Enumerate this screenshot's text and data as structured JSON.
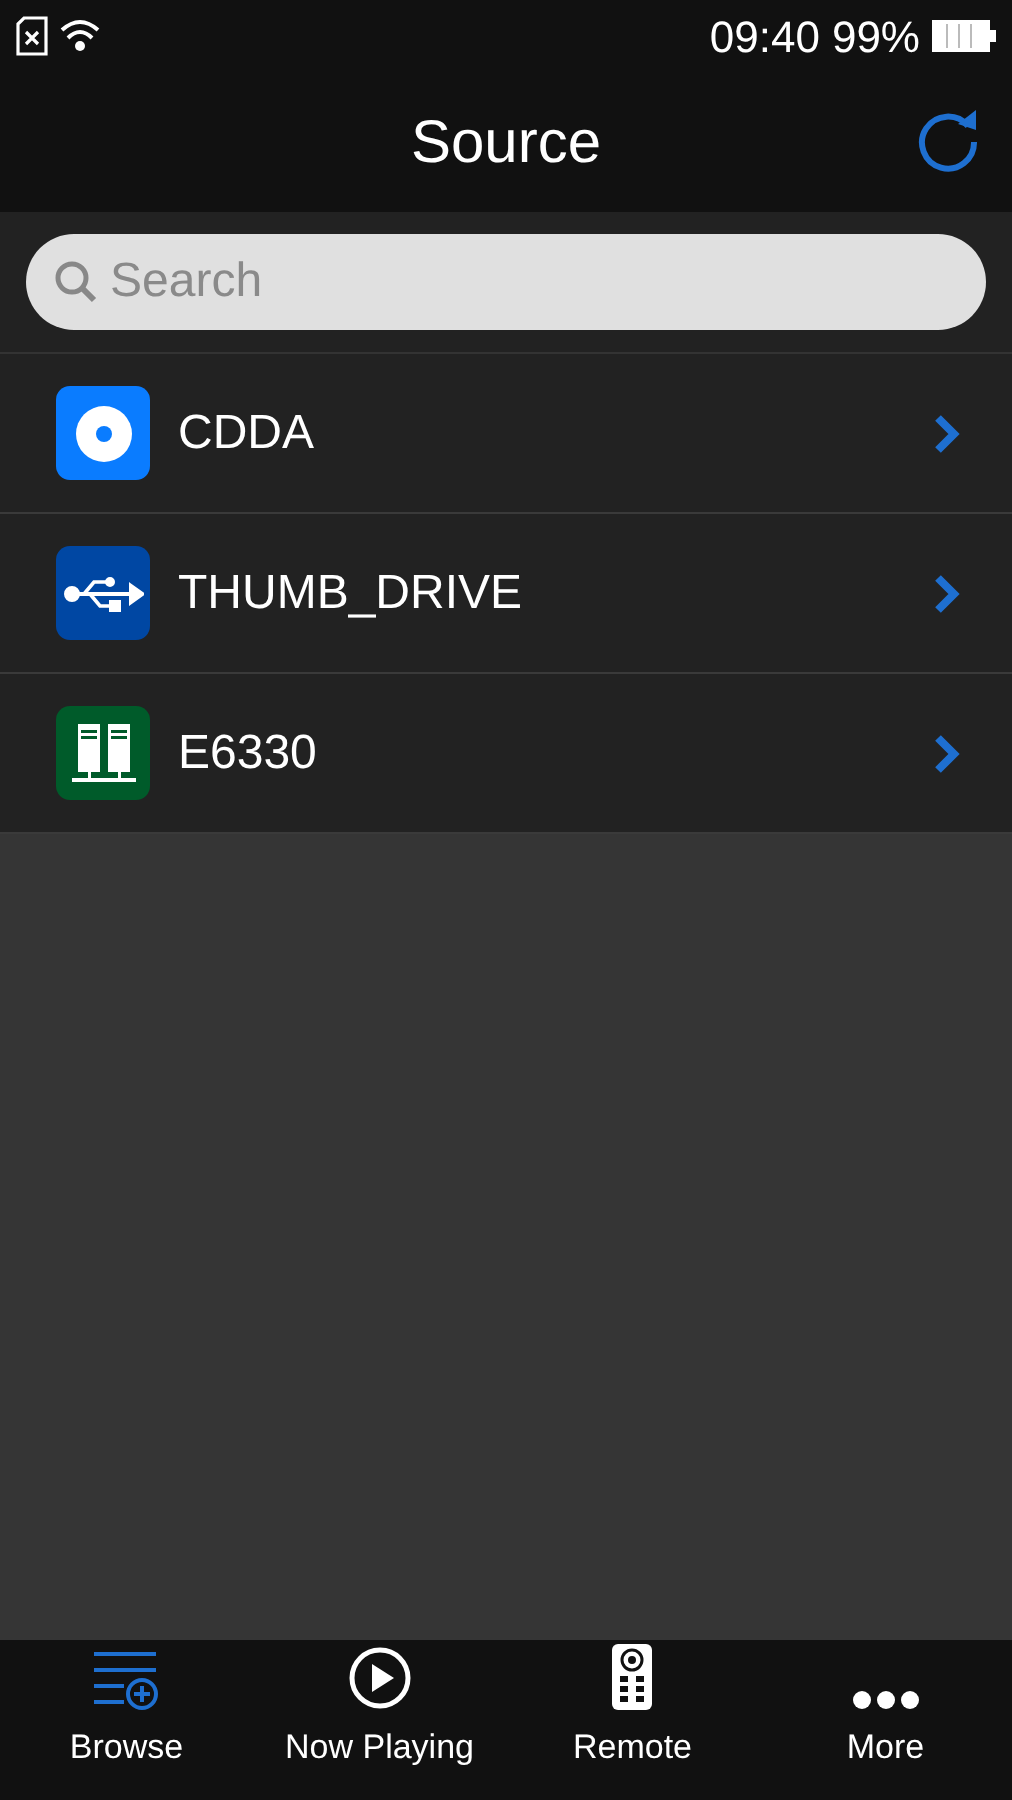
{
  "status_bar": {
    "time": "09:40",
    "battery": "99%"
  },
  "header": {
    "title": "Source"
  },
  "search": {
    "placeholder": "Search"
  },
  "sources": [
    {
      "kind": "disc",
      "label": "CDDA",
      "color": "#0a7cff"
    },
    {
      "kind": "usb",
      "label": "THUMB_DRIVE",
      "color": "#0047a3"
    },
    {
      "kind": "server",
      "label": "E6330",
      "color": "#005b2a"
    }
  ],
  "tabs": [
    {
      "kind": "browse",
      "label": "Browse",
      "selected": true
    },
    {
      "kind": "play",
      "label": "Now Playing",
      "selected": false
    },
    {
      "kind": "remote",
      "label": "Remote",
      "selected": false
    },
    {
      "kind": "more",
      "label": "More",
      "selected": false
    }
  ]
}
